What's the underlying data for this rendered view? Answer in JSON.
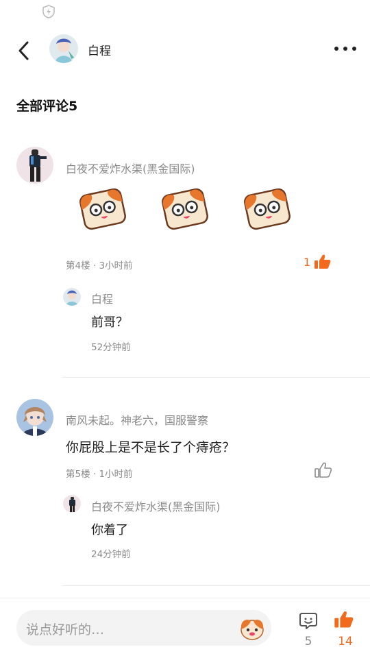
{
  "header": {
    "username": "白程"
  },
  "section": {
    "title": "全部评论5"
  },
  "comments": [
    {
      "username": "白夜不爱炸水渠(黑金国际)",
      "floor_time": "第4楼 · 3小时前",
      "like_count": "1",
      "reply": {
        "username": "白程",
        "text": "前哥？",
        "time": "52分钟前"
      }
    },
    {
      "username": "南风未起。神老六，国服警察",
      "text": "你屁股上是不是长了个痔疮？",
      "floor_time": "第5楼 · 1小时前",
      "reply": {
        "username": "白夜不爱炸水渠(黑金国际)",
        "text": "你着了",
        "time": "24分钟前"
      }
    }
  ],
  "bottom_bar": {
    "placeholder": "说点好听的…",
    "comment_count": "5",
    "like_count": "14"
  },
  "colors": {
    "accent": "#f26a1b",
    "muted": "#8a8a8a"
  },
  "icons": [
    "shield-bolt-icon",
    "back-arrow-icon",
    "more-icon",
    "thumb-up-icon",
    "comment-bubble-icon",
    "emoji-icon"
  ]
}
